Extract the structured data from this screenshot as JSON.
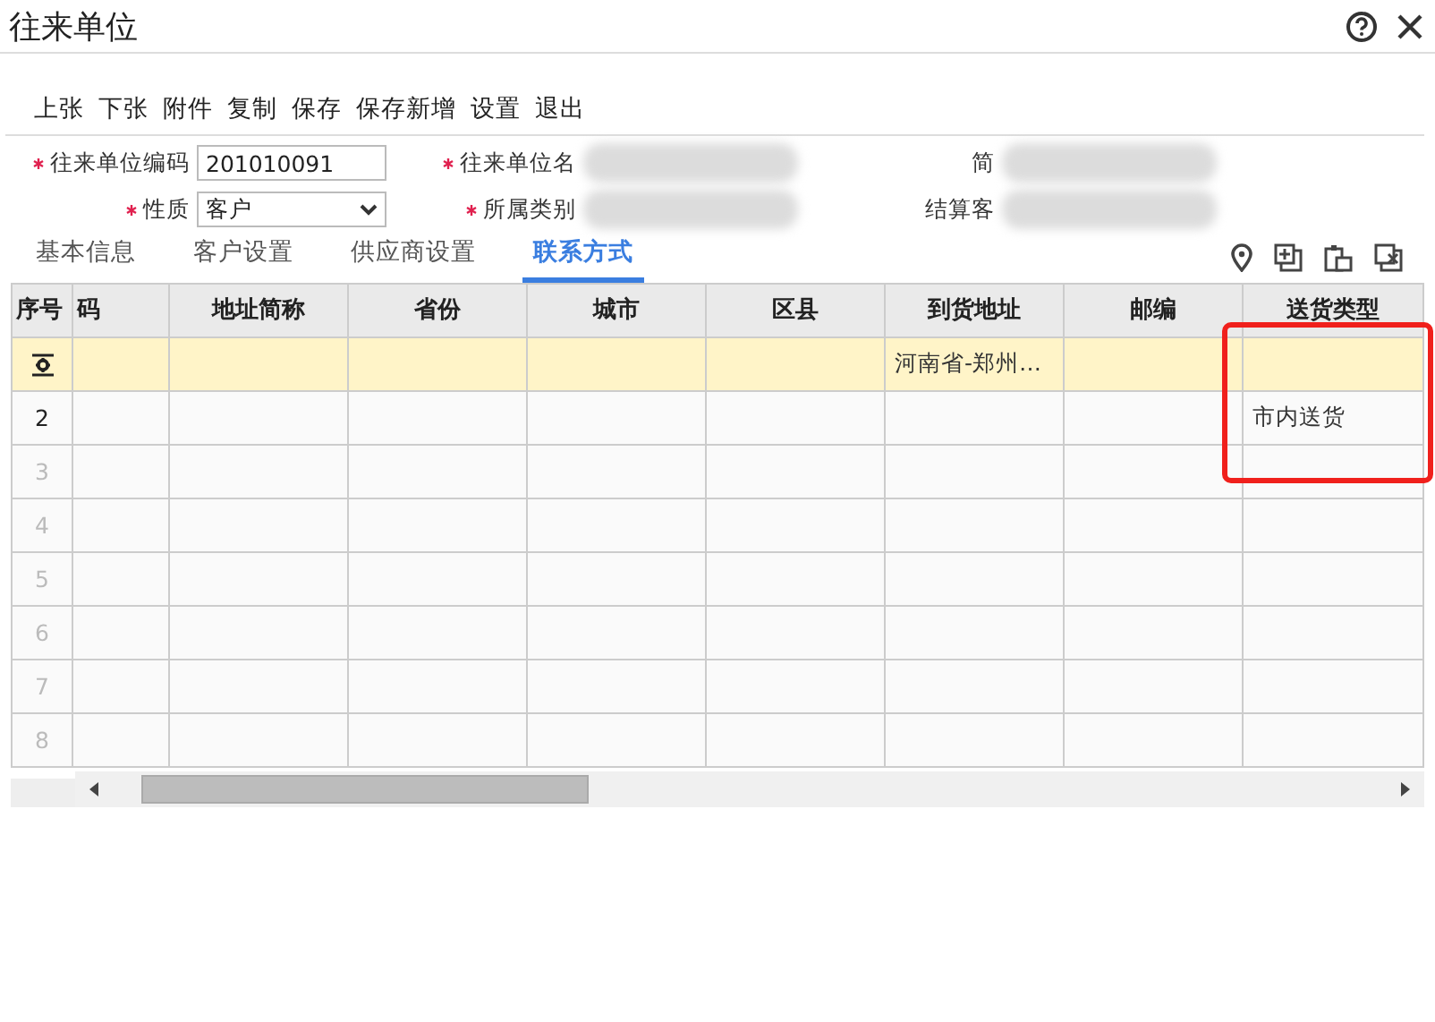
{
  "window": {
    "title": "往来单位"
  },
  "toolbar": [
    "上张",
    "下张",
    "附件",
    "复制",
    "保存",
    "保存新增",
    "设置",
    "退出"
  ],
  "form": [
    {
      "label": "往来单位编码",
      "required": true,
      "kind": "text",
      "value": "201010091"
    },
    {
      "label": "往来单位名",
      "required": true,
      "kind": "blurred"
    },
    {
      "label": "简",
      "required": false,
      "kind": "blurred"
    },
    {
      "label": "性质",
      "required": true,
      "kind": "select",
      "value": "客户"
    },
    {
      "label": "所属类别",
      "required": true,
      "kind": "blurred"
    },
    {
      "label": "结算客",
      "required": false,
      "kind": "blurred"
    }
  ],
  "tabs": [
    {
      "label": "基本信息",
      "selected": false
    },
    {
      "label": "客户设置",
      "selected": false
    },
    {
      "label": "供应商设置",
      "selected": false
    },
    {
      "label": "联系方式",
      "selected": true
    }
  ],
  "table": {
    "columns": [
      "序号",
      "码",
      "地址简称",
      "省份",
      "城市",
      "区县",
      "到货地址",
      "邮编",
      "送货类型"
    ],
    "rows": [
      {
        "selected": true,
        "kind": "edit",
        "cells": [
          "",
          "",
          "",
          "",
          "",
          "",
          "河南省-郑州…",
          "",
          ""
        ]
      },
      {
        "selected": false,
        "kind": "filled",
        "cells": [
          "2",
          "",
          "",
          "",
          "",
          "",
          "",
          "",
          "市内送货"
        ]
      },
      {
        "selected": false,
        "kind": "empty",
        "cells": [
          "3",
          "",
          "",
          "",
          "",
          "",
          "",
          "",
          ""
        ]
      },
      {
        "selected": false,
        "kind": "empty",
        "cells": [
          "4",
          "",
          "",
          "",
          "",
          "",
          "",
          "",
          ""
        ]
      },
      {
        "selected": false,
        "kind": "empty",
        "cells": [
          "5",
          "",
          "",
          "",
          "",
          "",
          "",
          "",
          ""
        ]
      },
      {
        "selected": false,
        "kind": "empty",
        "cells": [
          "6",
          "",
          "",
          "",
          "",
          "",
          "",
          "",
          ""
        ]
      },
      {
        "selected": false,
        "kind": "empty",
        "cells": [
          "7",
          "",
          "",
          "",
          "",
          "",
          "",
          "",
          ""
        ]
      },
      {
        "selected": false,
        "kind": "empty",
        "cells": [
          "8",
          "",
          "",
          "",
          "",
          "",
          "",
          "",
          ""
        ]
      }
    ]
  }
}
